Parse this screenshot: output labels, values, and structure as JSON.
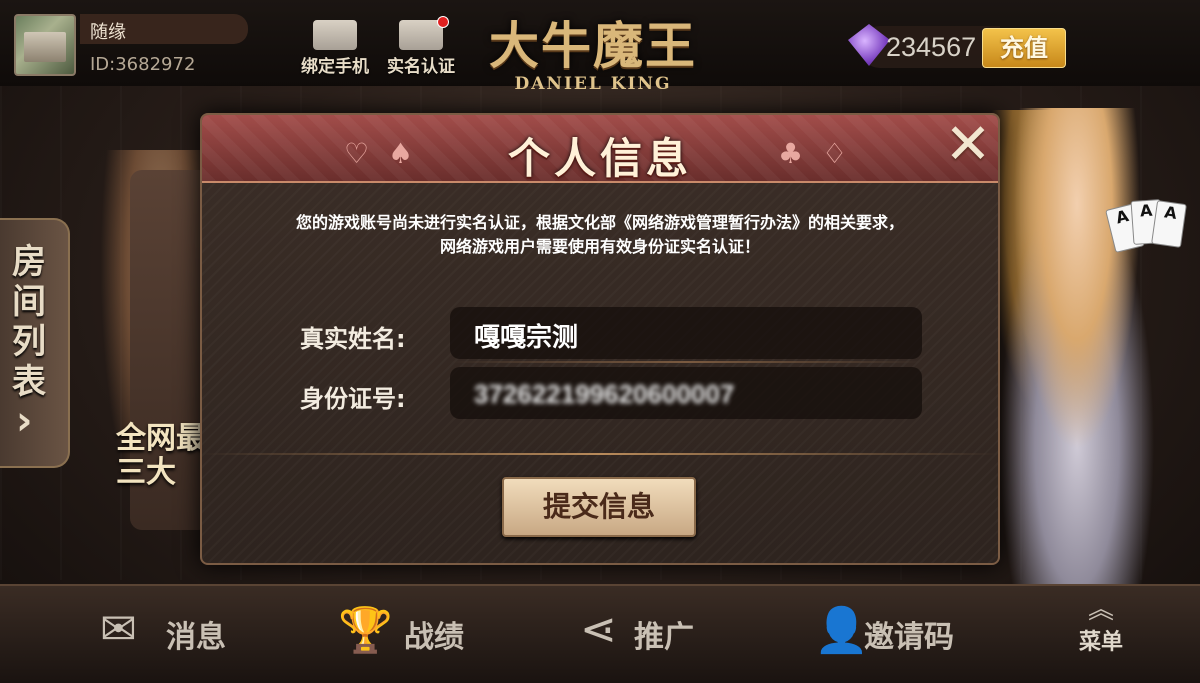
{
  "user": {
    "name": "随缘",
    "id": "ID:3682972"
  },
  "top_actions": {
    "bind_phone": "绑定手机",
    "real_name": "实名认证"
  },
  "logo": {
    "main": "大牛魔王",
    "sub": "DANIEL KING"
  },
  "balance": {
    "value": "234567",
    "recharge_label": "充值"
  },
  "sidebar": {
    "room_list": "房间列表",
    "arrow": "›",
    "promo": "全网最\n三大"
  },
  "modal": {
    "title": "个人信息",
    "close": "✕",
    "notice_line1": "您的游戏账号尚未进行实名认证，根据文化部《网络游戏管理暂行办法》的相关要求，",
    "notice_line2": "网络游戏用户需要使用有效身份证实名认证！",
    "name_label": "真实姓名:",
    "name_value": "嘎嘎宗测",
    "id_label": "身份证号:",
    "id_value": "372622199620600007",
    "submit_label": "提交信息"
  },
  "bottom_nav": {
    "messages": "消息",
    "records": "战绩",
    "promote": "推广",
    "invite_code": "邀请码",
    "menu": "菜单"
  },
  "colors": {
    "accent_gold": "#f3c24a",
    "modal_header": "#a24d4a",
    "notification": "#e02020"
  }
}
